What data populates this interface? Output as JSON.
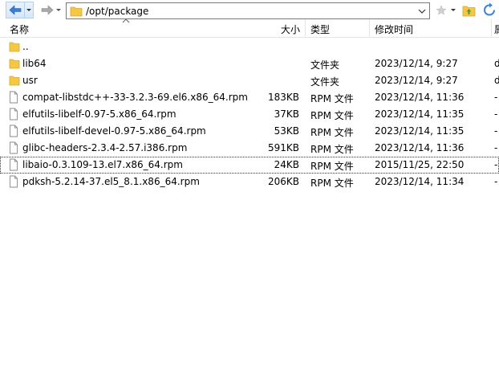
{
  "toolbar": {
    "path": "/opt/package",
    "back_icon": "back-arrow-icon",
    "forward_icon": "forward-arrow-icon",
    "path_folder_icon": "folder-icon",
    "bookmark_icon": "star-icon",
    "parent_icon": "up-folder-icon",
    "home_icon": "home-icon",
    "refresh_icon": "refresh-icon"
  },
  "columns": {
    "name": "名称",
    "size": "大小",
    "type": "类型",
    "modified": "修改时间",
    "extra": "属"
  },
  "rows": [
    {
      "icon": "folder-icon",
      "name": "..",
      "size": "",
      "type": "",
      "modified": "",
      "extra": ""
    },
    {
      "icon": "folder-icon",
      "name": "lib64",
      "size": "",
      "type": "文件夹",
      "modified": "2023/12/14, 9:27",
      "extra": "d"
    },
    {
      "icon": "folder-icon",
      "name": "usr",
      "size": "",
      "type": "文件夹",
      "modified": "2023/12/14, 9:27",
      "extra": "d"
    },
    {
      "icon": "file-icon",
      "name": "compat-libstdc++-33-3.2.3-69.el6.x86_64.rpm",
      "size": "183KB",
      "type": "RPM 文件",
      "modified": "2023/12/14, 11:36",
      "extra": "-"
    },
    {
      "icon": "file-icon",
      "name": "elfutils-libelf-0.97-5.x86_64.rpm",
      "size": "37KB",
      "type": "RPM 文件",
      "modified": "2023/12/14, 11:35",
      "extra": "-"
    },
    {
      "icon": "file-icon",
      "name": "elfutils-libelf-devel-0.97-5.x86_64.rpm",
      "size": "53KB",
      "type": "RPM 文件",
      "modified": "2023/12/14, 11:35",
      "extra": "-"
    },
    {
      "icon": "file-icon",
      "name": "glibc-headers-2.3.4-2.57.i386.rpm",
      "size": "591KB",
      "type": "RPM 文件",
      "modified": "2023/12/14, 11:36",
      "extra": "-"
    },
    {
      "icon": "file-icon",
      "name": "libaio-0.3.109-13.el7.x86_64.rpm",
      "size": "24KB",
      "type": "RPM 文件",
      "modified": "2015/11/25, 22:50",
      "extra": "-"
    },
    {
      "icon": "file-icon",
      "name": "pdksh-5.2.14-37.el5_8.1.x86_64.rpm",
      "size": "206KB",
      "type": "RPM 文件",
      "modified": "2023/12/14, 11:34",
      "extra": "-"
    }
  ]
}
